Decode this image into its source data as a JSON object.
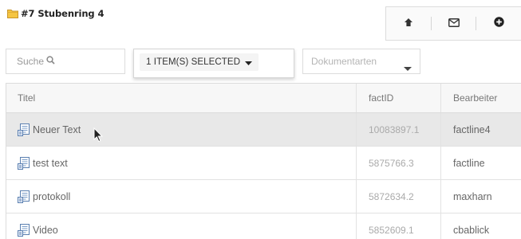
{
  "folder": {
    "title": "#7 Stubenring 4",
    "icon": "folder-icon"
  },
  "toolbar": {
    "buttons": [
      {
        "name": "upload",
        "icon": "arrow-up-icon"
      },
      {
        "name": "mail",
        "icon": "envelope-icon"
      },
      {
        "name": "add",
        "icon": "plus-circle-icon"
      }
    ]
  },
  "filters": {
    "search_placeholder": "Suche",
    "search_icon": "search-icon",
    "selection_label": "1 ITEM(S) SELECTED",
    "doctype_placeholder": "Dokumentarten"
  },
  "table": {
    "columns": [
      "Titel",
      "factID",
      "Bearbeiter"
    ],
    "rows": [
      {
        "title": "Neuer Text",
        "factid": "10083897.1",
        "editor": "factline4",
        "selected": true
      },
      {
        "title": "test text",
        "factid": "5875766.3",
        "editor": "factline",
        "selected": false
      },
      {
        "title": "protokoll",
        "factid": "5872634.2",
        "editor": "maxharn",
        "selected": false
      },
      {
        "title": "Video",
        "factid": "5852609.1",
        "editor": "cbablick",
        "selected": false
      }
    ]
  },
  "colors": {
    "accent_folder": "#f5c542",
    "selected_row": "#e8e8e8",
    "border": "#dcdcdc"
  }
}
